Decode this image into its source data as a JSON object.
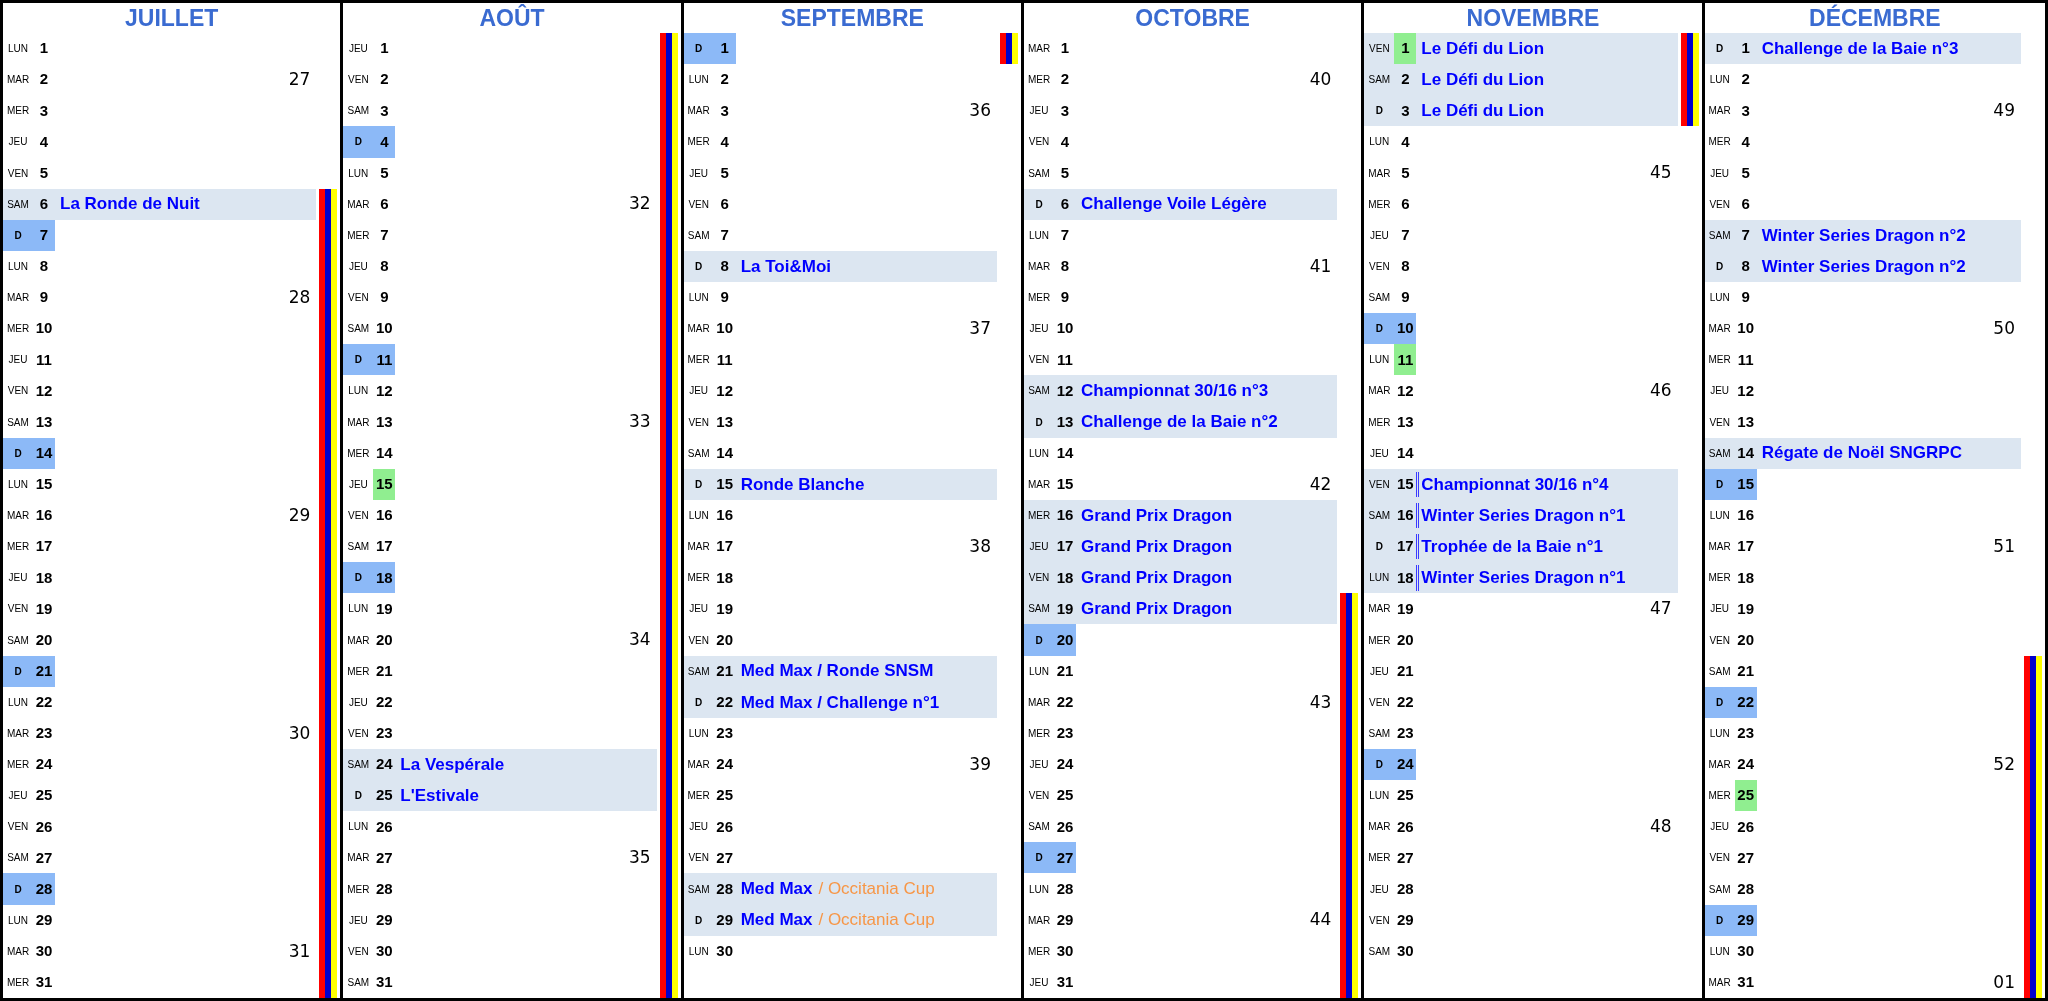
{
  "months": [
    {
      "name": "JUILLET",
      "days": [
        {
          "dow": "LUN",
          "day": "1",
          "sunday": false,
          "public_holiday": false,
          "school_holiday": false
        },
        {
          "dow": "MAR",
          "day": "2",
          "sunday": false,
          "public_holiday": false,
          "school_holiday": false,
          "week": "27"
        },
        {
          "dow": "MER",
          "day": "3",
          "sunday": false,
          "public_holiday": false,
          "school_holiday": false
        },
        {
          "dow": "JEU",
          "day": "4",
          "sunday": false,
          "public_holiday": false,
          "school_holiday": false
        },
        {
          "dow": "VEN",
          "day": "5",
          "sunday": false,
          "public_holiday": false,
          "school_holiday": false
        },
        {
          "dow": "SAM",
          "day": "6",
          "sunday": false,
          "public_holiday": false,
          "school_holiday": true,
          "event": {
            "title": "La Ronde de Nuit",
            "left_rule": false
          }
        },
        {
          "dow": "D",
          "day": "7",
          "sunday": true,
          "public_holiday": false,
          "school_holiday": true
        },
        {
          "dow": "LUN",
          "day": "8",
          "sunday": false,
          "public_holiday": false,
          "school_holiday": true
        },
        {
          "dow": "MAR",
          "day": "9",
          "sunday": false,
          "public_holiday": false,
          "school_holiday": true,
          "week": "28"
        },
        {
          "dow": "MER",
          "day": "10",
          "sunday": false,
          "public_holiday": false,
          "school_holiday": true
        },
        {
          "dow": "JEU",
          "day": "11",
          "sunday": false,
          "public_holiday": false,
          "school_holiday": true
        },
        {
          "dow": "VEN",
          "day": "12",
          "sunday": false,
          "public_holiday": false,
          "school_holiday": true
        },
        {
          "dow": "SAM",
          "day": "13",
          "sunday": false,
          "public_holiday": false,
          "school_holiday": true
        },
        {
          "dow": "D",
          "day": "14",
          "sunday": true,
          "public_holiday": false,
          "school_holiday": true
        },
        {
          "dow": "LUN",
          "day": "15",
          "sunday": false,
          "public_holiday": false,
          "school_holiday": true
        },
        {
          "dow": "MAR",
          "day": "16",
          "sunday": false,
          "public_holiday": false,
          "school_holiday": true,
          "week": "29"
        },
        {
          "dow": "MER",
          "day": "17",
          "sunday": false,
          "public_holiday": false,
          "school_holiday": true
        },
        {
          "dow": "JEU",
          "day": "18",
          "sunday": false,
          "public_holiday": false,
          "school_holiday": true
        },
        {
          "dow": "VEN",
          "day": "19",
          "sunday": false,
          "public_holiday": false,
          "school_holiday": true
        },
        {
          "dow": "SAM",
          "day": "20",
          "sunday": false,
          "public_holiday": false,
          "school_holiday": true
        },
        {
          "dow": "D",
          "day": "21",
          "sunday": true,
          "public_holiday": false,
          "school_holiday": true
        },
        {
          "dow": "LUN",
          "day": "22",
          "sunday": false,
          "public_holiday": false,
          "school_holiday": true
        },
        {
          "dow": "MAR",
          "day": "23",
          "sunday": false,
          "public_holiday": false,
          "school_holiday": true,
          "week": "30"
        },
        {
          "dow": "MER",
          "day": "24",
          "sunday": false,
          "public_holiday": false,
          "school_holiday": true
        },
        {
          "dow": "JEU",
          "day": "25",
          "sunday": false,
          "public_holiday": false,
          "school_holiday": true
        },
        {
          "dow": "VEN",
          "day": "26",
          "sunday": false,
          "public_holiday": false,
          "school_holiday": true
        },
        {
          "dow": "SAM",
          "day": "27",
          "sunday": false,
          "public_holiday": false,
          "school_holiday": true
        },
        {
          "dow": "D",
          "day": "28",
          "sunday": true,
          "public_holiday": false,
          "school_holiday": true
        },
        {
          "dow": "LUN",
          "day": "29",
          "sunday": false,
          "public_holiday": false,
          "school_holiday": true
        },
        {
          "dow": "MAR",
          "day": "30",
          "sunday": false,
          "public_holiday": false,
          "school_holiday": true,
          "week": "31"
        },
        {
          "dow": "MER",
          "day": "31",
          "sunday": false,
          "public_holiday": false,
          "school_holiday": true
        }
      ]
    },
    {
      "name": "AOÛT",
      "days": [
        {
          "dow": "JEU",
          "day": "1",
          "sunday": false,
          "public_holiday": false,
          "school_holiday": true
        },
        {
          "dow": "VEN",
          "day": "2",
          "sunday": false,
          "public_holiday": false,
          "school_holiday": true
        },
        {
          "dow": "SAM",
          "day": "3",
          "sunday": false,
          "public_holiday": false,
          "school_holiday": true
        },
        {
          "dow": "D",
          "day": "4",
          "sunday": true,
          "public_holiday": false,
          "school_holiday": true
        },
        {
          "dow": "LUN",
          "day": "5",
          "sunday": false,
          "public_holiday": false,
          "school_holiday": true
        },
        {
          "dow": "MAR",
          "day": "6",
          "sunday": false,
          "public_holiday": false,
          "school_holiday": true,
          "week": "32"
        },
        {
          "dow": "MER",
          "day": "7",
          "sunday": false,
          "public_holiday": false,
          "school_holiday": true
        },
        {
          "dow": "JEU",
          "day": "8",
          "sunday": false,
          "public_holiday": false,
          "school_holiday": true
        },
        {
          "dow": "VEN",
          "day": "9",
          "sunday": false,
          "public_holiday": false,
          "school_holiday": true
        },
        {
          "dow": "SAM",
          "day": "10",
          "sunday": false,
          "public_holiday": false,
          "school_holiday": true
        },
        {
          "dow": "D",
          "day": "11",
          "sunday": true,
          "public_holiday": false,
          "school_holiday": true
        },
        {
          "dow": "LUN",
          "day": "12",
          "sunday": false,
          "public_holiday": false,
          "school_holiday": true
        },
        {
          "dow": "MAR",
          "day": "13",
          "sunday": false,
          "public_holiday": false,
          "school_holiday": true,
          "week": "33"
        },
        {
          "dow": "MER",
          "day": "14",
          "sunday": false,
          "public_holiday": false,
          "school_holiday": true
        },
        {
          "dow": "JEU",
          "day": "15",
          "sunday": false,
          "public_holiday": true,
          "school_holiday": true
        },
        {
          "dow": "VEN",
          "day": "16",
          "sunday": false,
          "public_holiday": false,
          "school_holiday": true
        },
        {
          "dow": "SAM",
          "day": "17",
          "sunday": false,
          "public_holiday": false,
          "school_holiday": true
        },
        {
          "dow": "D",
          "day": "18",
          "sunday": true,
          "public_holiday": false,
          "school_holiday": true
        },
        {
          "dow": "LUN",
          "day": "19",
          "sunday": false,
          "public_holiday": false,
          "school_holiday": true
        },
        {
          "dow": "MAR",
          "day": "20",
          "sunday": false,
          "public_holiday": false,
          "school_holiday": true,
          "week": "34"
        },
        {
          "dow": "MER",
          "day": "21",
          "sunday": false,
          "public_holiday": false,
          "school_holiday": true
        },
        {
          "dow": "JEU",
          "day": "22",
          "sunday": false,
          "public_holiday": false,
          "school_holiday": true
        },
        {
          "dow": "VEN",
          "day": "23",
          "sunday": false,
          "public_holiday": false,
          "school_holiday": true
        },
        {
          "dow": "SAM",
          "day": "24",
          "sunday": false,
          "public_holiday": false,
          "school_holiday": true,
          "event": {
            "title": "La Vespérale",
            "left_rule": false
          }
        },
        {
          "dow": "D",
          "day": "25",
          "sunday": false,
          "public_holiday": false,
          "school_holiday": true,
          "event": {
            "title": "L'Estivale",
            "left_rule": false
          }
        },
        {
          "dow": "LUN",
          "day": "26",
          "sunday": false,
          "public_holiday": false,
          "school_holiday": true
        },
        {
          "dow": "MAR",
          "day": "27",
          "sunday": false,
          "public_holiday": false,
          "school_holiday": true,
          "week": "35"
        },
        {
          "dow": "MER",
          "day": "28",
          "sunday": false,
          "public_holiday": false,
          "school_holiday": true
        },
        {
          "dow": "JEU",
          "day": "29",
          "sunday": false,
          "public_holiday": false,
          "school_holiday": true
        },
        {
          "dow": "VEN",
          "day": "30",
          "sunday": false,
          "public_holiday": false,
          "school_holiday": true
        },
        {
          "dow": "SAM",
          "day": "31",
          "sunday": false,
          "public_holiday": false,
          "school_holiday": true
        }
      ]
    },
    {
      "name": "SEPTEMBRE",
      "days": [
        {
          "dow": "D",
          "day": "1",
          "sunday": true,
          "public_holiday": false,
          "school_holiday": true
        },
        {
          "dow": "LUN",
          "day": "2",
          "sunday": false,
          "public_holiday": false,
          "school_holiday": false
        },
        {
          "dow": "MAR",
          "day": "3",
          "sunday": false,
          "public_holiday": false,
          "school_holiday": false,
          "week": "36"
        },
        {
          "dow": "MER",
          "day": "4",
          "sunday": false,
          "public_holiday": false,
          "school_holiday": false
        },
        {
          "dow": "JEU",
          "day": "5",
          "sunday": false,
          "public_holiday": false,
          "school_holiday": false
        },
        {
          "dow": "VEN",
          "day": "6",
          "sunday": false,
          "public_holiday": false,
          "school_holiday": false
        },
        {
          "dow": "SAM",
          "day": "7",
          "sunday": false,
          "public_holiday": false,
          "school_holiday": false
        },
        {
          "dow": "D",
          "day": "8",
          "sunday": false,
          "public_holiday": false,
          "school_holiday": false,
          "event": {
            "title": "La Toi&Moi",
            "left_rule": false
          }
        },
        {
          "dow": "LUN",
          "day": "9",
          "sunday": false,
          "public_holiday": false,
          "school_holiday": false
        },
        {
          "dow": "MAR",
          "day": "10",
          "sunday": false,
          "public_holiday": false,
          "school_holiday": false,
          "week": "37"
        },
        {
          "dow": "MER",
          "day": "11",
          "sunday": false,
          "public_holiday": false,
          "school_holiday": false
        },
        {
          "dow": "JEU",
          "day": "12",
          "sunday": false,
          "public_holiday": false,
          "school_holiday": false
        },
        {
          "dow": "VEN",
          "day": "13",
          "sunday": false,
          "public_holiday": false,
          "school_holiday": false
        },
        {
          "dow": "SAM",
          "day": "14",
          "sunday": false,
          "public_holiday": false,
          "school_holiday": false
        },
        {
          "dow": "D",
          "day": "15",
          "sunday": false,
          "public_holiday": false,
          "school_holiday": false,
          "event": {
            "title": "Ronde Blanche",
            "left_rule": false
          }
        },
        {
          "dow": "LUN",
          "day": "16",
          "sunday": false,
          "public_holiday": false,
          "school_holiday": false
        },
        {
          "dow": "MAR",
          "day": "17",
          "sunday": false,
          "public_holiday": false,
          "school_holiday": false,
          "week": "38"
        },
        {
          "dow": "MER",
          "day": "18",
          "sunday": false,
          "public_holiday": false,
          "school_holiday": false
        },
        {
          "dow": "JEU",
          "day": "19",
          "sunday": false,
          "public_holiday": false,
          "school_holiday": false
        },
        {
          "dow": "VEN",
          "day": "20",
          "sunday": false,
          "public_holiday": false,
          "school_holiday": false
        },
        {
          "dow": "SAM",
          "day": "21",
          "sunday": false,
          "public_holiday": false,
          "school_holiday": false,
          "event": {
            "title": "Med Max / Ronde SNSM",
            "left_rule": false
          }
        },
        {
          "dow": "D",
          "day": "22",
          "sunday": false,
          "public_holiday": false,
          "school_holiday": false,
          "event": {
            "title": "Med Max / Challenge n°1",
            "left_rule": false
          }
        },
        {
          "dow": "LUN",
          "day": "23",
          "sunday": false,
          "public_holiday": false,
          "school_holiday": false
        },
        {
          "dow": "MAR",
          "day": "24",
          "sunday": false,
          "public_holiday": false,
          "school_holiday": false,
          "week": "39"
        },
        {
          "dow": "MER",
          "day": "25",
          "sunday": false,
          "public_holiday": false,
          "school_holiday": false
        },
        {
          "dow": "JEU",
          "day": "26",
          "sunday": false,
          "public_holiday": false,
          "school_holiday": false
        },
        {
          "dow": "VEN",
          "day": "27",
          "sunday": false,
          "public_holiday": false,
          "school_holiday": false
        },
        {
          "dow": "SAM",
          "day": "28",
          "sunday": false,
          "public_holiday": false,
          "school_holiday": false,
          "event": {
            "title": "Med Max",
            "note": "/ Occitania Cup",
            "left_rule": false
          }
        },
        {
          "dow": "D",
          "day": "29",
          "sunday": false,
          "public_holiday": false,
          "school_holiday": false,
          "event": {
            "title": "Med Max",
            "note": "/ Occitania Cup",
            "left_rule": false
          }
        },
        {
          "dow": "LUN",
          "day": "30",
          "sunday": false,
          "public_holiday": false,
          "school_holiday": false
        }
      ]
    },
    {
      "name": "OCTOBRE",
      "days": [
        {
          "dow": "MAR",
          "day": "1",
          "sunday": false,
          "public_holiday": false,
          "school_holiday": false
        },
        {
          "dow": "MER",
          "day": "2",
          "sunday": false,
          "public_holiday": false,
          "school_holiday": false,
          "week": "40"
        },
        {
          "dow": "JEU",
          "day": "3",
          "sunday": false,
          "public_holiday": false,
          "school_holiday": false
        },
        {
          "dow": "VEN",
          "day": "4",
          "sunday": false,
          "public_holiday": false,
          "school_holiday": false
        },
        {
          "dow": "SAM",
          "day": "5",
          "sunday": false,
          "public_holiday": false,
          "school_holiday": false
        },
        {
          "dow": "D",
          "day": "6",
          "sunday": false,
          "public_holiday": false,
          "school_holiday": false,
          "event": {
            "title": "Challenge Voile Légère",
            "left_rule": false
          }
        },
        {
          "dow": "LUN",
          "day": "7",
          "sunday": false,
          "public_holiday": false,
          "school_holiday": false
        },
        {
          "dow": "MAR",
          "day": "8",
          "sunday": false,
          "public_holiday": false,
          "school_holiday": false,
          "week": "41"
        },
        {
          "dow": "MER",
          "day": "9",
          "sunday": false,
          "public_holiday": false,
          "school_holiday": false
        },
        {
          "dow": "JEU",
          "day": "10",
          "sunday": false,
          "public_holiday": false,
          "school_holiday": false
        },
        {
          "dow": "VEN",
          "day": "11",
          "sunday": false,
          "public_holiday": false,
          "school_holiday": false
        },
        {
          "dow": "SAM",
          "day": "12",
          "sunday": false,
          "public_holiday": false,
          "school_holiday": false,
          "event": {
            "title": "Championnat 30/16 n°3",
            "left_rule": false
          }
        },
        {
          "dow": "D",
          "day": "13",
          "sunday": false,
          "public_holiday": false,
          "school_holiday": false,
          "event": {
            "title": "Challenge de la Baie n°2",
            "left_rule": false
          }
        },
        {
          "dow": "LUN",
          "day": "14",
          "sunday": false,
          "public_holiday": false,
          "school_holiday": false
        },
        {
          "dow": "MAR",
          "day": "15",
          "sunday": false,
          "public_holiday": false,
          "school_holiday": false,
          "week": "42"
        },
        {
          "dow": "MER",
          "day": "16",
          "sunday": false,
          "public_holiday": false,
          "school_holiday": false,
          "event": {
            "title": "Grand Prix Dragon",
            "left_rule": false
          }
        },
        {
          "dow": "JEU",
          "day": "17",
          "sunday": false,
          "public_holiday": false,
          "school_holiday": false,
          "event": {
            "title": "Grand Prix Dragon",
            "left_rule": false
          }
        },
        {
          "dow": "VEN",
          "day": "18",
          "sunday": false,
          "public_holiday": false,
          "school_holiday": false,
          "event": {
            "title": "Grand Prix Dragon",
            "left_rule": false
          }
        },
        {
          "dow": "SAM",
          "day": "19",
          "sunday": false,
          "public_holiday": false,
          "school_holiday": true,
          "event": {
            "title": "Grand Prix Dragon",
            "left_rule": false
          }
        },
        {
          "dow": "D",
          "day": "20",
          "sunday": true,
          "public_holiday": false,
          "school_holiday": true
        },
        {
          "dow": "LUN",
          "day": "21",
          "sunday": false,
          "public_holiday": false,
          "school_holiday": true
        },
        {
          "dow": "MAR",
          "day": "22",
          "sunday": false,
          "public_holiday": false,
          "school_holiday": true,
          "week": "43"
        },
        {
          "dow": "MER",
          "day": "23",
          "sunday": false,
          "public_holiday": false,
          "school_holiday": true
        },
        {
          "dow": "JEU",
          "day": "24",
          "sunday": false,
          "public_holiday": false,
          "school_holiday": true
        },
        {
          "dow": "VEN",
          "day": "25",
          "sunday": false,
          "public_holiday": false,
          "school_holiday": true
        },
        {
          "dow": "SAM",
          "day": "26",
          "sunday": false,
          "public_holiday": false,
          "school_holiday": true
        },
        {
          "dow": "D",
          "day": "27",
          "sunday": true,
          "public_holiday": false,
          "school_holiday": true
        },
        {
          "dow": "LUN",
          "day": "28",
          "sunday": false,
          "public_holiday": false,
          "school_holiday": true
        },
        {
          "dow": "MAR",
          "day": "29",
          "sunday": false,
          "public_holiday": false,
          "school_holiday": true,
          "week": "44"
        },
        {
          "dow": "MER",
          "day": "30",
          "sunday": false,
          "public_holiday": false,
          "school_holiday": true
        },
        {
          "dow": "JEU",
          "day": "31",
          "sunday": false,
          "public_holiday": false,
          "school_holiday": true
        }
      ]
    },
    {
      "name": "NOVEMBRE",
      "days": [
        {
          "dow": "VEN",
          "day": "1",
          "sunday": false,
          "public_holiday": true,
          "school_holiday": true,
          "event": {
            "title": "Le Défi du Lion",
            "left_rule": false
          }
        },
        {
          "dow": "SAM",
          "day": "2",
          "sunday": false,
          "public_holiday": false,
          "school_holiday": true,
          "event": {
            "title": "Le Défi du Lion",
            "left_rule": false
          }
        },
        {
          "dow": "D",
          "day": "3",
          "sunday": false,
          "public_holiday": false,
          "school_holiday": true,
          "event": {
            "title": "Le Défi du Lion",
            "left_rule": false
          }
        },
        {
          "dow": "LUN",
          "day": "4",
          "sunday": false,
          "public_holiday": false,
          "school_holiday": false
        },
        {
          "dow": "MAR",
          "day": "5",
          "sunday": false,
          "public_holiday": false,
          "school_holiday": false,
          "week": "45"
        },
        {
          "dow": "MER",
          "day": "6",
          "sunday": false,
          "public_holiday": false,
          "school_holiday": false
        },
        {
          "dow": "JEU",
          "day": "7",
          "sunday": false,
          "public_holiday": false,
          "school_holiday": false
        },
        {
          "dow": "VEN",
          "day": "8",
          "sunday": false,
          "public_holiday": false,
          "school_holiday": false
        },
        {
          "dow": "SAM",
          "day": "9",
          "sunday": false,
          "public_holiday": false,
          "school_holiday": false
        },
        {
          "dow": "D",
          "day": "10",
          "sunday": true,
          "public_holiday": false,
          "school_holiday": false
        },
        {
          "dow": "LUN",
          "day": "11",
          "sunday": false,
          "public_holiday": true,
          "school_holiday": false
        },
        {
          "dow": "MAR",
          "day": "12",
          "sunday": false,
          "public_holiday": false,
          "school_holiday": false,
          "week": "46"
        },
        {
          "dow": "MER",
          "day": "13",
          "sunday": false,
          "public_holiday": false,
          "school_holiday": false
        },
        {
          "dow": "JEU",
          "day": "14",
          "sunday": false,
          "public_holiday": false,
          "school_holiday": false
        },
        {
          "dow": "VEN",
          "day": "15",
          "sunday": false,
          "public_holiday": false,
          "school_holiday": false,
          "event": {
            "title": "Championnat 30/16 n°4",
            "left_rule": true
          }
        },
        {
          "dow": "SAM",
          "day": "16",
          "sunday": false,
          "public_holiday": false,
          "school_holiday": false,
          "event": {
            "title": "Winter Series Dragon n°1",
            "left_rule": true
          }
        },
        {
          "dow": "D",
          "day": "17",
          "sunday": false,
          "public_holiday": false,
          "school_holiday": false,
          "event": {
            "title": "Trophée de la Baie n°1",
            "left_rule": true
          }
        },
        {
          "dow": "LUN",
          "day": "18",
          "sunday": false,
          "public_holiday": false,
          "school_holiday": false,
          "event": {
            "title": "Winter Series Dragon n°1",
            "left_rule": true
          }
        },
        {
          "dow": "MAR",
          "day": "19",
          "sunday": false,
          "public_holiday": false,
          "school_holiday": false,
          "week": "47"
        },
        {
          "dow": "MER",
          "day": "20",
          "sunday": false,
          "public_holiday": false,
          "school_holiday": false
        },
        {
          "dow": "JEU",
          "day": "21",
          "sunday": false,
          "public_holiday": false,
          "school_holiday": false
        },
        {
          "dow": "VEN",
          "day": "22",
          "sunday": false,
          "public_holiday": false,
          "school_holiday": false
        },
        {
          "dow": "SAM",
          "day": "23",
          "sunday": false,
          "public_holiday": false,
          "school_holiday": false
        },
        {
          "dow": "D",
          "day": "24",
          "sunday": true,
          "public_holiday": false,
          "school_holiday": false
        },
        {
          "dow": "LUN",
          "day": "25",
          "sunday": false,
          "public_holiday": false,
          "school_holiday": false
        },
        {
          "dow": "MAR",
          "day": "26",
          "sunday": false,
          "public_holiday": false,
          "school_holiday": false,
          "week": "48"
        },
        {
          "dow": "MER",
          "day": "27",
          "sunday": false,
          "public_holiday": false,
          "school_holiday": false
        },
        {
          "dow": "JEU",
          "day": "28",
          "sunday": false,
          "public_holiday": false,
          "school_holiday": false
        },
        {
          "dow": "VEN",
          "day": "29",
          "sunday": false,
          "public_holiday": false,
          "school_holiday": false
        },
        {
          "dow": "SAM",
          "day": "30",
          "sunday": false,
          "public_holiday": false,
          "school_holiday": false
        }
      ]
    },
    {
      "name": "DÉCEMBRE",
      "days": [
        {
          "dow": "D",
          "day": "1",
          "sunday": false,
          "public_holiday": false,
          "school_holiday": false,
          "event": {
            "title": "Challenge de la Baie n°3",
            "left_rule": false
          }
        },
        {
          "dow": "LUN",
          "day": "2",
          "sunday": false,
          "public_holiday": false,
          "school_holiday": false
        },
        {
          "dow": "MAR",
          "day": "3",
          "sunday": false,
          "public_holiday": false,
          "school_holiday": false,
          "week": "49"
        },
        {
          "dow": "MER",
          "day": "4",
          "sunday": false,
          "public_holiday": false,
          "school_holiday": false
        },
        {
          "dow": "JEU",
          "day": "5",
          "sunday": false,
          "public_holiday": false,
          "school_holiday": false
        },
        {
          "dow": "VEN",
          "day": "6",
          "sunday": false,
          "public_holiday": false,
          "school_holiday": false
        },
        {
          "dow": "SAM",
          "day": "7",
          "sunday": false,
          "public_holiday": false,
          "school_holiday": false,
          "event": {
            "title": "Winter Series Dragon n°2",
            "left_rule": false
          }
        },
        {
          "dow": "D",
          "day": "8",
          "sunday": false,
          "public_holiday": false,
          "school_holiday": false,
          "event": {
            "title": "Winter Series Dragon n°2",
            "left_rule": false
          }
        },
        {
          "dow": "LUN",
          "day": "9",
          "sunday": false,
          "public_holiday": false,
          "school_holiday": false
        },
        {
          "dow": "MAR",
          "day": "10",
          "sunday": false,
          "public_holiday": false,
          "school_holiday": false,
          "week": "50"
        },
        {
          "dow": "MER",
          "day": "11",
          "sunday": false,
          "public_holiday": false,
          "school_holiday": false
        },
        {
          "dow": "JEU",
          "day": "12",
          "sunday": false,
          "public_holiday": false,
          "school_holiday": false
        },
        {
          "dow": "VEN",
          "day": "13",
          "sunday": false,
          "public_holiday": false,
          "school_holiday": false
        },
        {
          "dow": "SAM",
          "day": "14",
          "sunday": false,
          "public_holiday": false,
          "school_holiday": false,
          "event": {
            "title": "Régate de Noël SNGRPC",
            "left_rule": false
          }
        },
        {
          "dow": "D",
          "day": "15",
          "sunday": true,
          "public_holiday": false,
          "school_holiday": false
        },
        {
          "dow": "LUN",
          "day": "16",
          "sunday": false,
          "public_holiday": false,
          "school_holiday": false
        },
        {
          "dow": "MAR",
          "day": "17",
          "sunday": false,
          "public_holiday": false,
          "school_holiday": false,
          "week": "51"
        },
        {
          "dow": "MER",
          "day": "18",
          "sunday": false,
          "public_holiday": false,
          "school_holiday": false
        },
        {
          "dow": "JEU",
          "day": "19",
          "sunday": false,
          "public_holiday": false,
          "school_holiday": false
        },
        {
          "dow": "VEN",
          "day": "20",
          "sunday": false,
          "public_holiday": false,
          "school_holiday": false
        },
        {
          "dow": "SAM",
          "day": "21",
          "sunday": false,
          "public_holiday": false,
          "school_holiday": true
        },
        {
          "dow": "D",
          "day": "22",
          "sunday": true,
          "public_holiday": false,
          "school_holiday": true
        },
        {
          "dow": "LUN",
          "day": "23",
          "sunday": false,
          "public_holiday": false,
          "school_holiday": true
        },
        {
          "dow": "MAR",
          "day": "24",
          "sunday": false,
          "public_holiday": false,
          "school_holiday": true,
          "week": "52"
        },
        {
          "dow": "MER",
          "day": "25",
          "sunday": false,
          "public_holiday": true,
          "school_holiday": true
        },
        {
          "dow": "JEU",
          "day": "26",
          "sunday": false,
          "public_holiday": false,
          "school_holiday": true
        },
        {
          "dow": "VEN",
          "day": "27",
          "sunday": false,
          "public_holiday": false,
          "school_holiday": true
        },
        {
          "dow": "SAM",
          "day": "28",
          "sunday": false,
          "public_holiday": false,
          "school_holiday": true
        },
        {
          "dow": "D",
          "day": "29",
          "sunday": true,
          "public_holiday": false,
          "school_holiday": true
        },
        {
          "dow": "LUN",
          "day": "30",
          "sunday": false,
          "public_holiday": false,
          "school_holiday": true
        },
        {
          "dow": "MAR",
          "day": "31",
          "sunday": false,
          "public_holiday": false,
          "school_holiday": true,
          "week": "01"
        }
      ]
    }
  ]
}
